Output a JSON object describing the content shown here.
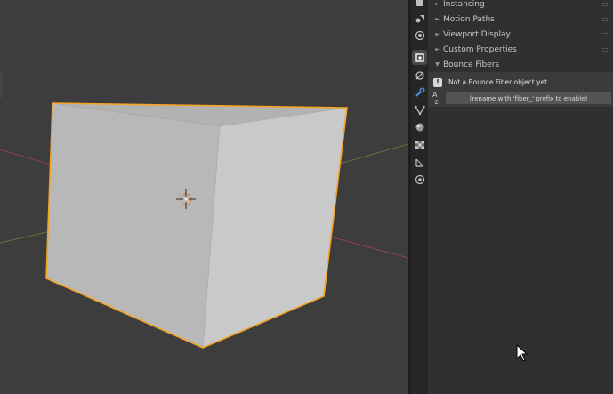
{
  "properties": {
    "panels": [
      {
        "label": "Instancing",
        "expanded": false
      },
      {
        "label": "Motion Paths",
        "expanded": false
      },
      {
        "label": "Viewport Display",
        "expanded": false
      },
      {
        "label": "Custom Properties",
        "expanded": false
      },
      {
        "label": "Bounce Fibers",
        "expanded": true
      }
    ],
    "bounce_fibers": {
      "info_icon": "info-icon",
      "info_message": "Not a Bounce Fiber object yet.",
      "sort_icon": "sort-alpha-icon",
      "rename_hint": "(rename with 'fiber_' prefix to enable)"
    }
  },
  "tabs": [
    {
      "name": "render-tab",
      "icon": "camera-back-icon"
    },
    {
      "name": "scene-tab",
      "icon": "scene-icon"
    },
    {
      "name": "world-tab",
      "icon": "world-icon"
    },
    {
      "name": "object-tab",
      "icon": "object-square-icon",
      "active": true
    },
    {
      "name": "physics-tab",
      "icon": "physics-icon"
    },
    {
      "name": "modifiers-tab",
      "icon": "wrench-icon"
    },
    {
      "name": "particles-tab",
      "icon": "particles-icon"
    },
    {
      "name": "physics-sphere-tab",
      "icon": "sphere-icon"
    },
    {
      "name": "texture-tab",
      "icon": "checker-icon"
    },
    {
      "name": "constraints-tab",
      "icon": "constraint-icon"
    },
    {
      "name": "data-tab",
      "icon": "target-icon"
    }
  ],
  "colors": {
    "selection_outline": "#f5a323",
    "cube_front": "#b8b8b8",
    "cube_side": "#c9c9c9",
    "cube_top": "#b2b2b2",
    "axis_x": "#c84a55",
    "axis_y": "#7a9a3a"
  }
}
